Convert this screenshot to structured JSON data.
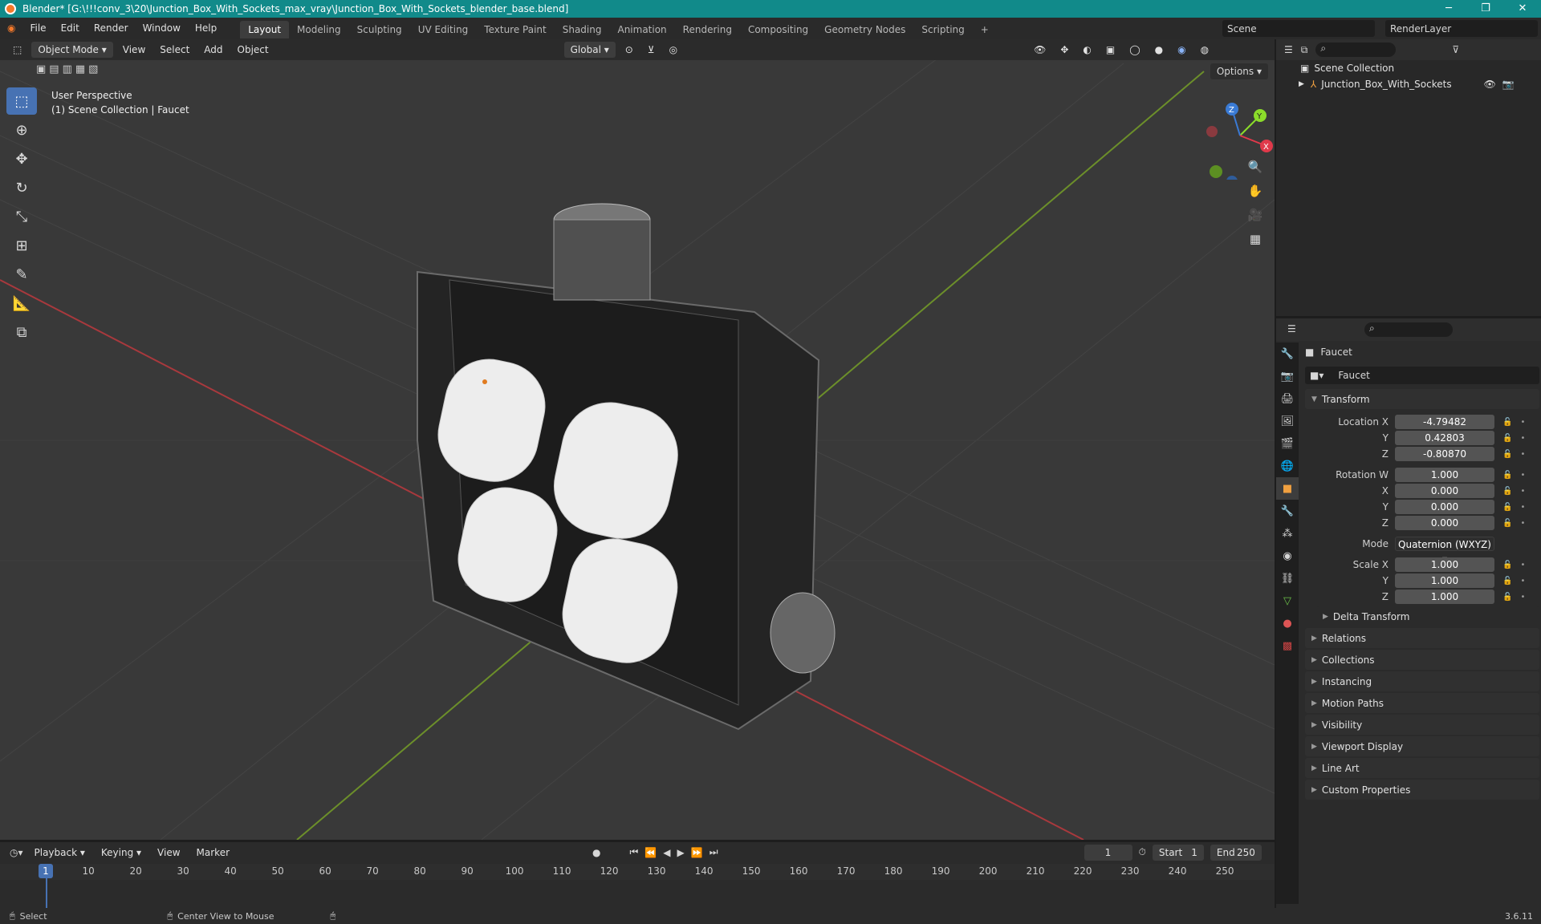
{
  "window": {
    "title": "Blender* [G:\\!!!conv_3\\20\\Junction_Box_With_Sockets_max_vray\\Junction_Box_With_Sockets_blender_base.blend]",
    "min": "─",
    "max": "❐",
    "close": "✕"
  },
  "menu": [
    "File",
    "Edit",
    "Render",
    "Window",
    "Help"
  ],
  "workspaces": [
    "Layout",
    "Modeling",
    "Sculpting",
    "UV Editing",
    "Texture Paint",
    "Shading",
    "Animation",
    "Rendering",
    "Compositing",
    "Geometry Nodes",
    "Scripting",
    "+"
  ],
  "scene": "Scene",
  "view_layer": "RenderLayer",
  "viewport": {
    "mode": "Object Mode",
    "menus": [
      "View",
      "Select",
      "Add",
      "Object"
    ],
    "orientation": "Global",
    "options": "Options",
    "perspective": "User Perspective",
    "collection_info": "(1) Scene Collection | Faucet"
  },
  "gizmo": {
    "x": "X",
    "y": "Y",
    "z": "Z"
  },
  "outliner": {
    "root": "Scene Collection",
    "item": "Junction_Box_With_Sockets"
  },
  "props": {
    "object_name": "Faucet",
    "data_name": "Faucet",
    "transform": "Transform",
    "location": {
      "label": "Location X",
      "x": "-4.79482",
      "y": "0.42803",
      "z": "-0.80870"
    },
    "rotation": {
      "label": "Rotation W",
      "w": "1.000",
      "x": "0.000",
      "y": "0.000",
      "z": "0.000"
    },
    "mode": {
      "label": "Mode",
      "value": "Quaternion (WXYZ)"
    },
    "scale": {
      "label": "Scale X",
      "x": "1.000",
      "y": "1.000",
      "z": "1.000"
    },
    "axis_labels": {
      "y": "Y",
      "z": "Z",
      "x": "X"
    },
    "delta": "Delta Transform",
    "panels": [
      "Relations",
      "Collections",
      "Instancing",
      "Motion Paths",
      "Visibility",
      "Viewport Display",
      "Line Art",
      "Custom Properties"
    ]
  },
  "timeline": {
    "menus": [
      "Playback",
      "Keying",
      "View",
      "Marker"
    ],
    "current": "1",
    "start_label": "Start",
    "start": "1",
    "end_label": "End",
    "end": "250",
    "ticks": [
      "1",
      "10",
      "20",
      "30",
      "40",
      "50",
      "60",
      "70",
      "80",
      "90",
      "100",
      "110",
      "120",
      "130",
      "140",
      "150",
      "160",
      "170",
      "180",
      "190",
      "200",
      "210",
      "220",
      "230",
      "240",
      "250"
    ]
  },
  "status": {
    "select": "Select",
    "center": "Center View to Mouse",
    "version": "3.6.11"
  }
}
